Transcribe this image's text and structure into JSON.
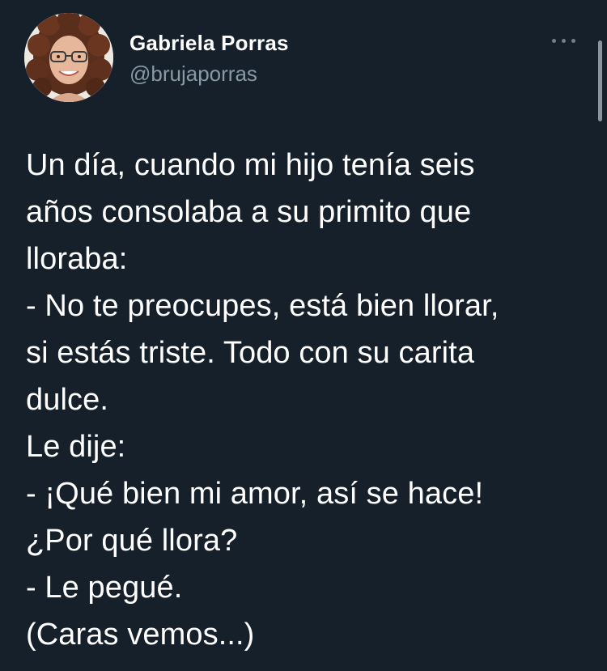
{
  "author": {
    "display_name": "Gabriela Porras",
    "handle": "@brujaporras",
    "avatar_icon": "profile-photo"
  },
  "more_icon": "ellipsis-icon",
  "tweet": {
    "lines": [
      "Un día, cuando mi hijo tenía seis",
      "años consolaba a su primito que",
      "lloraba:",
      "- No te preocupes, está bien llorar,",
      "si estás triste. Todo con su carita",
      "dulce.",
      "Le dije:",
      "- ¡Qué bien mi amor, así se hace!",
      "¿Por qué llora?",
      "- Le pegué.",
      "(Caras vemos...)"
    ]
  },
  "colors": {
    "background": "#15202b",
    "text_primary": "#ffffff",
    "text_secondary": "#8899a6"
  }
}
